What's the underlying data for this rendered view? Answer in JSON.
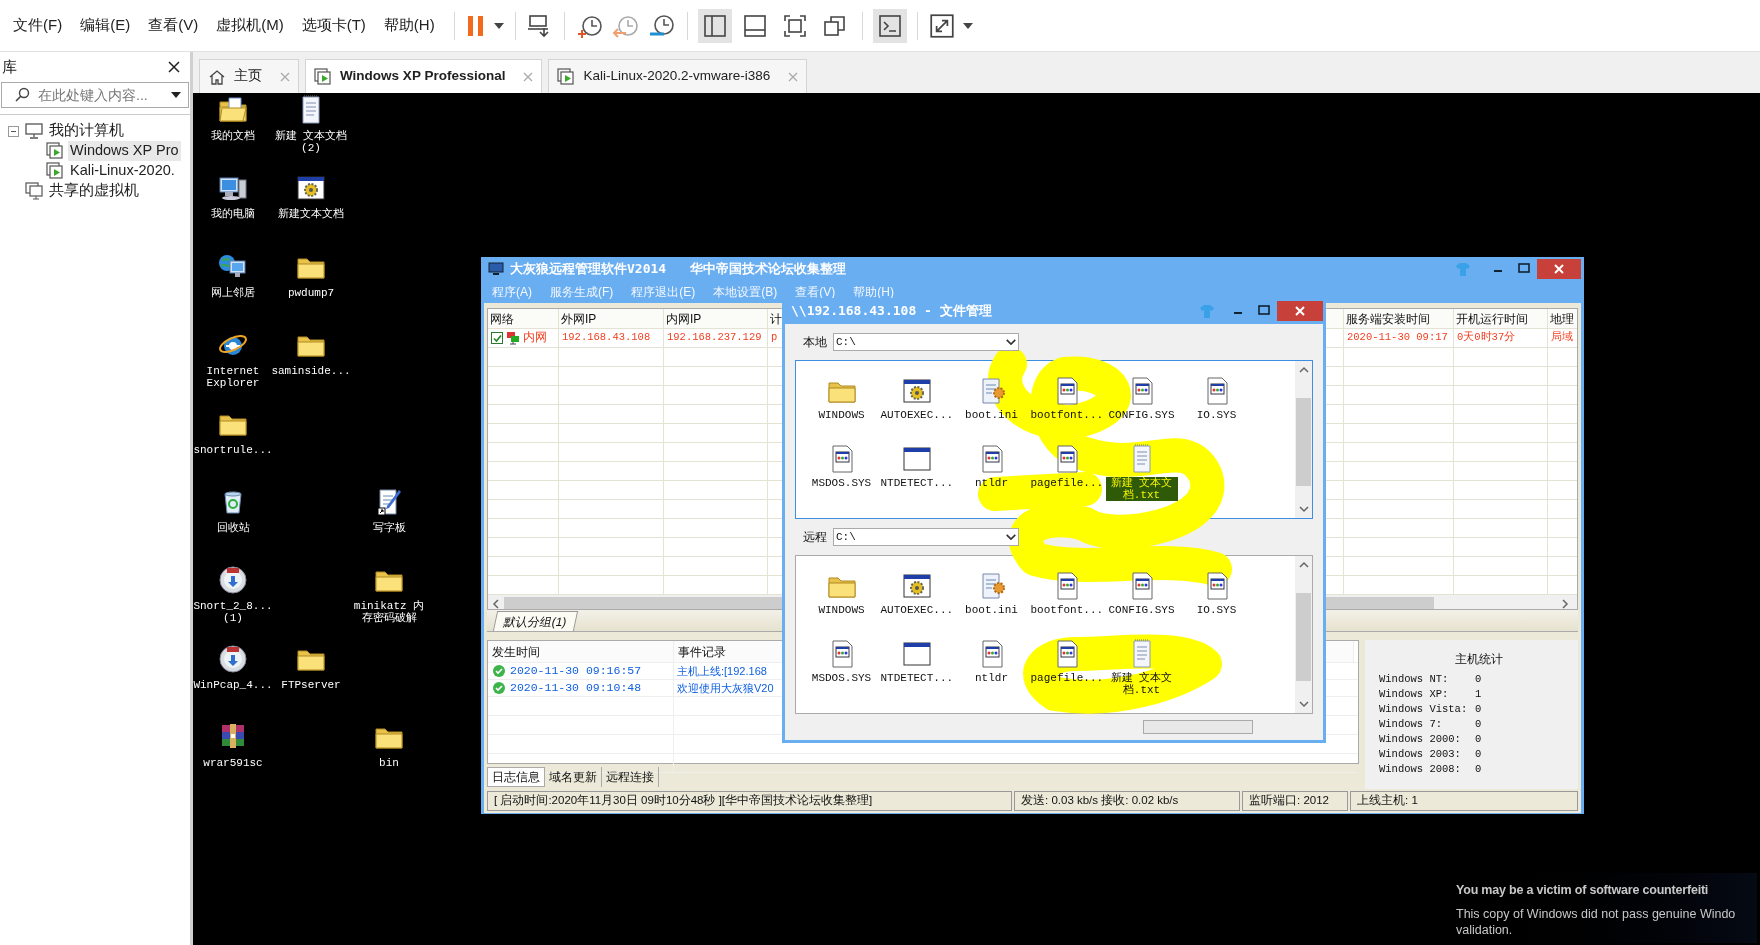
{
  "menu_bar": [
    "文件(F)",
    "编辑(E)",
    "查看(V)",
    "虚拟机(M)",
    "选项卡(T)",
    "帮助(H)"
  ],
  "library": {
    "title": "库",
    "search": {
      "placeholder": "在此处键入内容..."
    },
    "tree": [
      {
        "label": "我的计算机",
        "expanded": true,
        "children": [
          {
            "label": "Windows XP Pro",
            "selected": true
          },
          {
            "label": "Kali-Linux-2020.",
            "selected": false
          }
        ]
      },
      {
        "label": "共享的虚拟机"
      }
    ]
  },
  "tabs": [
    {
      "label": "主页",
      "kind": "home",
      "selected": false
    },
    {
      "label": "Windows XP Professional",
      "kind": "vm",
      "selected": true
    },
    {
      "label": "Kali-Linux-2020.2-vmware-i386",
      "kind": "vm",
      "selected": false
    }
  ],
  "desktop_icons": [
    {
      "label": "我的文档",
      "kind": "mydocs"
    },
    {
      "label": "新建 文本文档 (2)",
      "kind": "textfile"
    },
    {
      "label": "我的电脑",
      "kind": "computer"
    },
    {
      "label": "新建文本文档",
      "kind": "app"
    },
    {
      "label": "网上邻居",
      "kind": "network"
    },
    {
      "label": "pwdump7",
      "kind": "folder"
    },
    {
      "label": "Internet Explorer",
      "kind": "browser"
    },
    {
      "label": "saminside...",
      "kind": "folder"
    },
    {
      "label": "snortrule...",
      "kind": "folder"
    },
    {
      "label": "回收站",
      "kind": "recycle"
    },
    {
      "label": "写字板",
      "kind": "wordpad"
    },
    {
      "label": "Snort_2_8... (1)",
      "kind": "installer"
    },
    {
      "label": "minikatz 内存密码破解",
      "kind": "folder"
    },
    {
      "label": "WinPcap_4...",
      "kind": "installer"
    },
    {
      "label": "FTPserver",
      "kind": "folder"
    },
    {
      "label": "wrar591sc",
      "kind": "archive"
    },
    {
      "label": "bin",
      "kind": "folder"
    }
  ],
  "app_window": {
    "title": "大灰狼远程管理软件V2014   华中帝国技术论坛收集整理",
    "menu": [
      "程序(A)",
      "服务生成(F)",
      "程序退出(E)",
      "本地设置(B)",
      "查看(V)",
      "帮助(H)"
    ],
    "hosts_table": {
      "columns": [
        "网络",
        "外网IP",
        "内网IP",
        "计",
        "服务端安装时间",
        "开机运行时间",
        "地理"
      ],
      "rows": [
        {
          "checked": true,
          "cells": [
            "内网",
            "192.168.43.108",
            "192.168.237.129",
            "p",
            "2020-11-30 09:17",
            "0天0时37分",
            "局域"
          ]
        }
      ]
    },
    "group_tab": "默认分组(1)",
    "log": {
      "columns": [
        "发生时间",
        "事件记录"
      ],
      "rows": [
        {
          "time": "2020-11-30 09:16:57",
          "event": "主机上线:[192.168"
        },
        {
          "time": "2020-11-30 09:10:48",
          "event": "欢迎使用大灰狼V20"
        }
      ]
    },
    "host_stats": {
      "title": "主机统计",
      "items": [
        {
          "label": "Windows NT:",
          "value": "0"
        },
        {
          "label": "Windows XP:",
          "value": "1"
        },
        {
          "label": "Windows Vista:",
          "value": "0"
        },
        {
          "label": "Windows 7:",
          "value": "0"
        },
        {
          "label": "Windows 2000:",
          "value": "0"
        },
        {
          "label": "Windows 2003:",
          "value": "0"
        },
        {
          "label": "Windows 2008:",
          "value": "0"
        }
      ]
    },
    "bottom_tabs": [
      {
        "label": "日志信息",
        "selected": true
      },
      {
        "label": "域名更新",
        "selected": false
      },
      {
        "label": "远程连接",
        "selected": false
      }
    ],
    "status_bar": [
      "[ 启动时间:2020年11月30日 09时10分48秒 ][华中帝国技术论坛收集整理]",
      "发送: 0.03 kb/s 接收: 0.02 kb/s",
      "监听端口: 2012",
      "上线主机: 1"
    ]
  },
  "file_manager": {
    "title": "\\\\192.168.43.108 - 文件管理",
    "panes": [
      {
        "label": "本地",
        "path": "C:\\",
        "files": [
          {
            "name": "WINDOWS",
            "kind": "folder",
            "selected": false
          },
          {
            "name": "AUTOEXEC...",
            "kind": "app",
            "selected": false
          },
          {
            "name": "boot.ini",
            "kind": "ini",
            "selected": false
          },
          {
            "name": "bootfont...",
            "kind": "sys",
            "selected": false
          },
          {
            "name": "CONFIG.SYS",
            "kind": "sys",
            "selected": false
          },
          {
            "name": "IO.SYS",
            "kind": "sys",
            "selected": false
          },
          {
            "name": "MSDOS.SYS",
            "kind": "sys",
            "selected": false
          },
          {
            "name": "NTDETECT...",
            "kind": "window",
            "selected": false
          },
          {
            "name": "ntldr",
            "kind": "sys",
            "selected": false
          },
          {
            "name": "pagefile...",
            "kind": "sys",
            "selected": false
          },
          {
            "name": "新建 文本文档.txt",
            "kind": "text",
            "selected": true
          }
        ]
      },
      {
        "label": "远程",
        "path": "C:\\",
        "files": [
          {
            "name": "WINDOWS",
            "kind": "folder",
            "selected": false
          },
          {
            "name": "AUTOEXEC...",
            "kind": "app",
            "selected": false
          },
          {
            "name": "boot.ini",
            "kind": "ini",
            "selected": false
          },
          {
            "name": "bootfont...",
            "kind": "sys",
            "selected": false
          },
          {
            "name": "CONFIG.SYS",
            "kind": "sys",
            "selected": false
          },
          {
            "name": "IO.SYS",
            "kind": "sys",
            "selected": false
          },
          {
            "name": "MSDOS.SYS",
            "kind": "sys",
            "selected": false
          },
          {
            "name": "NTDETECT...",
            "kind": "window",
            "selected": false
          },
          {
            "name": "ntldr",
            "kind": "sys",
            "selected": false
          },
          {
            "name": "pagefile...",
            "kind": "sys",
            "selected": false
          },
          {
            "name": "新建 文本文档.txt",
            "kind": "text",
            "selected": false
          }
        ]
      }
    ]
  },
  "genuine_notice": {
    "title": "You may be a victim of software counterfeiti",
    "lines": [
      "This copy of Windows did not pass genuine Windo",
      "validation."
    ]
  }
}
